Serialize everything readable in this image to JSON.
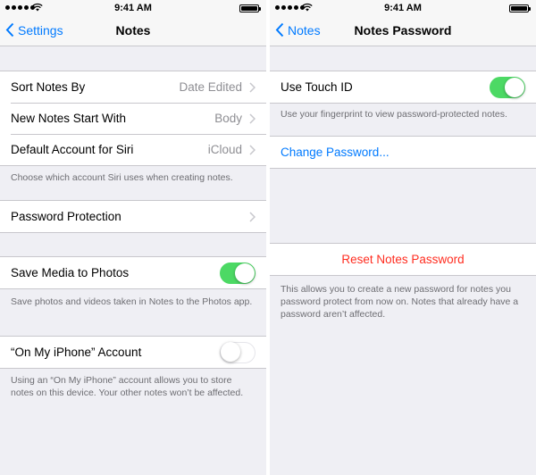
{
  "colors": {
    "accent": "#007aff",
    "toggle_on": "#4cd964",
    "destructive": "#ff2d20",
    "background": "#efeff4"
  },
  "left_screen": {
    "status": {
      "time": "9:41 AM"
    },
    "nav": {
      "back_label": "Settings",
      "title": "Notes"
    },
    "rows": {
      "sort": {
        "label": "Sort Notes By",
        "value": "Date Edited"
      },
      "new_notes": {
        "label": "New Notes Start With",
        "value": "Body"
      },
      "default_account": {
        "label": "Default Account for Siri",
        "value": "iCloud"
      },
      "password": {
        "label": "Password Protection"
      },
      "save_media": {
        "label": "Save Media to Photos",
        "toggle": true
      },
      "on_my_iphone": {
        "label": "“On My iPhone” Account",
        "toggle": false
      }
    },
    "footers": {
      "siri": "Choose which account Siri uses when creating notes.",
      "save_media": "Save photos and videos taken in Notes to the Photos app.",
      "on_my_iphone": "Using an “On My iPhone” account allows you to store notes on this device. Your other notes won’t be affected."
    }
  },
  "right_screen": {
    "status": {
      "time": "9:41 AM"
    },
    "nav": {
      "back_label": "Notes",
      "title": "Notes Password"
    },
    "rows": {
      "touch_id": {
        "label": "Use Touch ID",
        "toggle": true
      },
      "change_password": {
        "label": "Change Password..."
      },
      "reset": {
        "label": "Reset Notes Password"
      }
    },
    "footers": {
      "touch_id": "Use your fingerprint to view password-protected notes.",
      "reset": "This allows you to create a new password for notes you password protect from now on. Notes that already have a password aren’t affected."
    }
  }
}
